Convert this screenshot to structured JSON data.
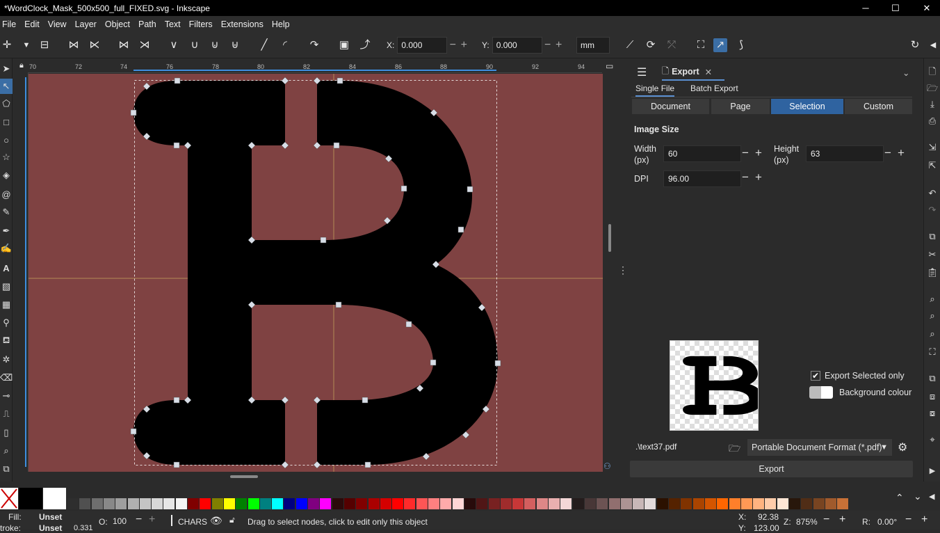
{
  "window": {
    "title": "*WordClock_Mask_500x500_full_FIXED.svg - Inkscape",
    "minimize": "─",
    "maximize": "☐",
    "close": "✕"
  },
  "menu": [
    "File",
    "Edit",
    "View",
    "Layer",
    "Object",
    "Path",
    "Text",
    "Filters",
    "Extensions",
    "Help"
  ],
  "toolbar": {
    "x_label": "X:",
    "x_value": "0.000",
    "y_label": "Y:",
    "y_value": "0.000",
    "unit": "mm"
  },
  "ruler": {
    "top_ticks": [
      "70",
      "72",
      "74",
      "76",
      "78",
      "80",
      "82",
      "84",
      "86",
      "88",
      "90",
      "92",
      "94"
    ]
  },
  "panel": {
    "tab_label": "Export",
    "modes": [
      "Single File",
      "Batch Export"
    ],
    "areas": [
      "Document",
      "Page",
      "Selection",
      "Custom"
    ],
    "active_area": "Selection",
    "image_size_heading": "Image Size",
    "width_label": "Width\n(px)",
    "width_value": "60",
    "height_label": "Height\n(px)",
    "height_value": "63",
    "dpi_label": "DPI",
    "dpi_value": "96.00",
    "export_selected_only": "Export Selected only",
    "background_colour": "Background colour",
    "filename": ".\\text37.pdf",
    "format": "Portable Document Format (*.pdf)",
    "export_button": "Export"
  },
  "status": {
    "fill_label": "Fill:",
    "fill_value": "Unset",
    "stroke_label": "troke:",
    "stroke_value": "Unset",
    "stroke_width": "0.331",
    "opacity_label": "O:",
    "opacity_value": "100",
    "layer": "CHARS",
    "message": "Drag to select nodes, click to edit only this object",
    "x_label": "X:",
    "x_value": "92.38",
    "y_label": "Y:",
    "y_value": "123.00",
    "zoom_label": "Z:",
    "zoom_value": "875%",
    "rotate_label": "R:",
    "rotate_value": "0.00°"
  },
  "palette": {
    "colors": [
      "#2e2e2e",
      "#505050",
      "#6e6e6e",
      "#888",
      "#9e9e9e",
      "#b0b0b0",
      "#c4c4c4",
      "#d7d7d7",
      "#e6e6e6",
      "#f4f4f4",
      "#800000",
      "#ff0000",
      "#808000",
      "#ffff00",
      "#008000",
      "#00ff00",
      "#008080",
      "#00ffff",
      "#000080",
      "#0000ff",
      "#800080",
      "#ff00ff",
      "#2b0a0a",
      "#550000",
      "#800000",
      "#aa0000",
      "#d40000",
      "#ff0000",
      "#ff2a2a",
      "#ff5555",
      "#ff8080",
      "#ffaaaa",
      "#ffd5d5",
      "#280b0b",
      "#501616",
      "#782121",
      "#a02c2c",
      "#c83737",
      "#d35f5f",
      "#de8787",
      "#e9afaf",
      "#f4d7d7",
      "#241c1c",
      "#483737",
      "#6c5353",
      "#916f6f",
      "#ac9393",
      "#c8b7b7",
      "#e3dbdb",
      "#2b1100",
      "#552200",
      "#803300",
      "#aa4400",
      "#d45500",
      "#ff6600",
      "#ff7f2a",
      "#ff9955",
      "#ffb380",
      "#ffccaa",
      "#ffe6d5",
      "#28170b",
      "#502d16",
      "#784421",
      "#a05a2c",
      "#c87137"
    ]
  }
}
